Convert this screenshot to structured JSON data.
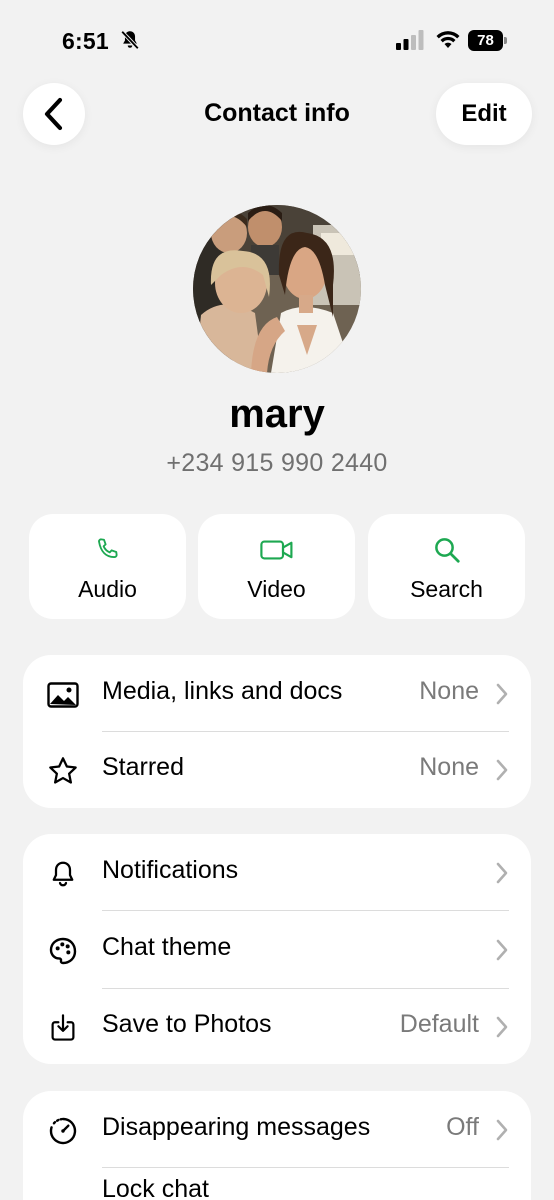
{
  "status_bar": {
    "time": "6:51",
    "battery": "78",
    "icons": [
      "bell-slash-icon",
      "cellular-signal-icon",
      "wifi-icon",
      "battery-icon"
    ]
  },
  "header": {
    "title": "Contact info",
    "edit_label": "Edit",
    "back_icon": "chevron-left-icon"
  },
  "contact": {
    "name": "mary",
    "phone": "+234 915 990 2440"
  },
  "actions": [
    {
      "label": "Audio",
      "icon": "phone-icon"
    },
    {
      "label": "Video",
      "icon": "video-camera-icon"
    },
    {
      "label": "Search",
      "icon": "search-icon"
    }
  ],
  "section1": [
    {
      "label": "Media, links and docs",
      "value": "None",
      "icon": "image-icon"
    },
    {
      "label": "Starred",
      "value": "None",
      "icon": "star-icon"
    }
  ],
  "section2": [
    {
      "label": "Notifications",
      "value": "",
      "icon": "bell-icon"
    },
    {
      "label": "Chat theme",
      "value": "",
      "icon": "palette-icon"
    },
    {
      "label": "Save to Photos",
      "value": "Default",
      "icon": "download-icon"
    }
  ],
  "section3": [
    {
      "label": "Disappearing messages",
      "value": "Off",
      "icon": "timer-icon"
    },
    {
      "label": "Lock chat",
      "value": "",
      "icon": "lock-icon"
    }
  ],
  "colors": {
    "accent": "#1da851",
    "background": "#f2f2f2",
    "card": "#ffffff",
    "secondary_text": "#7a7a7a"
  }
}
